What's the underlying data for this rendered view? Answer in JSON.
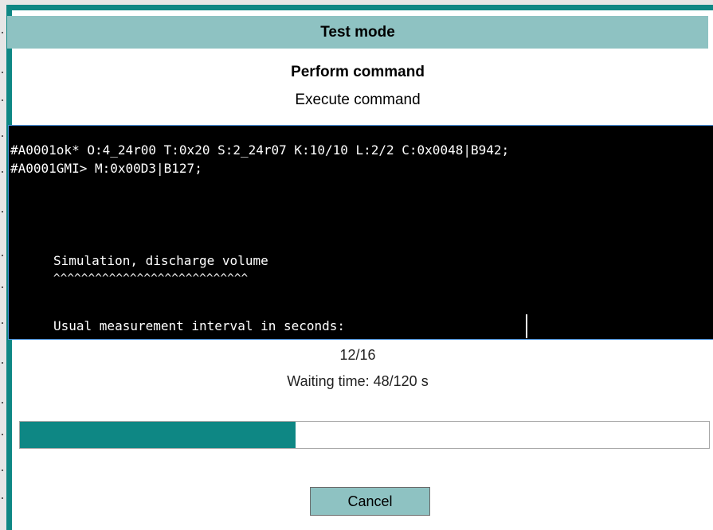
{
  "dialog": {
    "title": "Test mode",
    "heading": "Perform command",
    "subheading": "Execute command"
  },
  "console": {
    "lines": [
      "#A0001ok* O:4_24r00 T:0x20 S:2_24r07 K:10/10 L:2/2 C:0x0048|B942;",
      "#A0001GMI> M:0x00D3|B127;",
      "Simulation, discharge volume",
      "^^^^^^^^^^^^^^^^^^^^^^^^^^^^",
      "Usual measurement interval in seconds:"
    ]
  },
  "status": {
    "counter": "12/16",
    "waiting_time": "Waiting time: 48/120 s",
    "progress_fraction": 0.4
  },
  "buttons": {
    "cancel_label": "Cancel"
  },
  "colors": {
    "accent": "#0e8784",
    "title_bar": "#8ec2c2",
    "console_bg": "#000000",
    "console_fg": "#ffffff"
  }
}
